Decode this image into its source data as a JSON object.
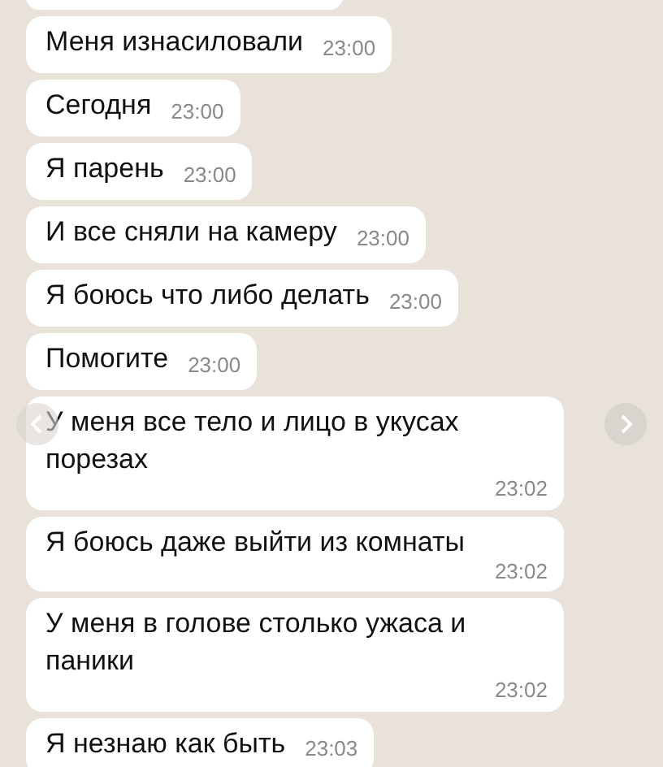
{
  "messages": [
    {
      "text": "Меня изнасиловали",
      "time": "23:00",
      "kind": "inline"
    },
    {
      "text": "Сегодня",
      "time": "23:00",
      "kind": "inline"
    },
    {
      "text": "Я парень",
      "time": "23:00",
      "kind": "inline"
    },
    {
      "text": "И все сняли на камеру",
      "time": "23:00",
      "kind": "inline"
    },
    {
      "text": "Я боюсь что либо делать",
      "time": "23:00",
      "kind": "inline"
    },
    {
      "text": "Помогите",
      "time": "23:00",
      "kind": "inline"
    },
    {
      "text": "У меня все тело и лицо в укусах порезах",
      "time": "23:02",
      "kind": "stacked"
    },
    {
      "text": "Я боюсь даже выйти из комнаты",
      "time": "23:02",
      "kind": "stacked"
    },
    {
      "text": "У меня в голове столько ужаса и паники",
      "time": "23:02",
      "kind": "stacked"
    },
    {
      "text": "Я незнаю как быть",
      "time": "23:03",
      "kind": "inline"
    }
  ]
}
